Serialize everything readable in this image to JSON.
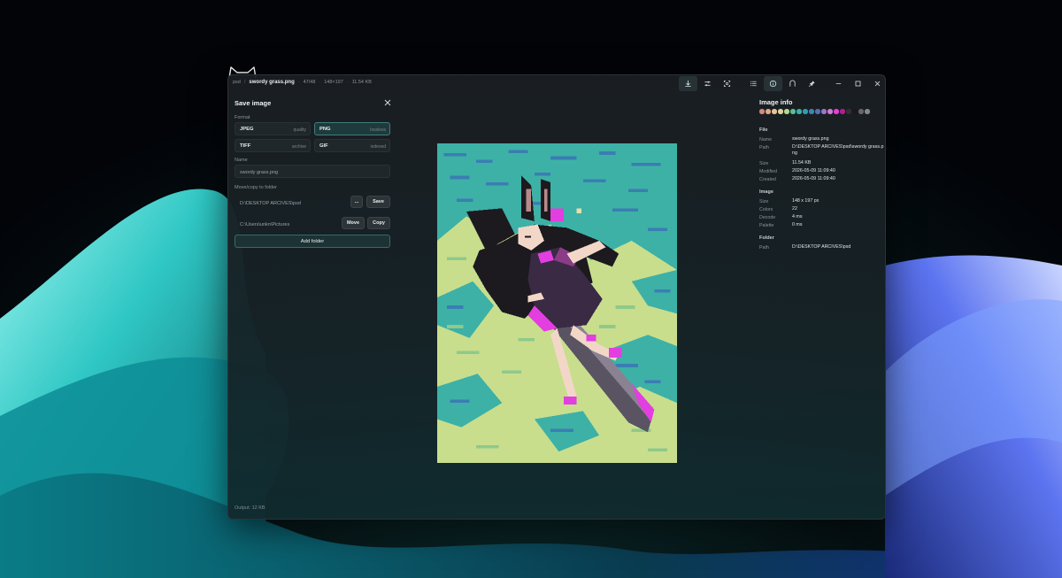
{
  "window": {
    "breadcrumb": {
      "folder": "psd",
      "separator": "/",
      "file": "swordy grass.png",
      "meta": [
        "47/48",
        "148×197",
        "11.54 KB"
      ]
    }
  },
  "toolbar": {
    "buttons": [
      {
        "icon": "download-icon",
        "active": true
      },
      {
        "icon": "sliders-icon",
        "active": false
      },
      {
        "icon": "fullscreen-icon",
        "active": false
      },
      {
        "icon": "list-icon",
        "active": false
      },
      {
        "icon": "info-icon",
        "active": true
      },
      {
        "icon": "magnet-icon",
        "active": false
      },
      {
        "icon": "pin-icon",
        "active": false
      }
    ],
    "window_controls": [
      "minimize-icon",
      "maximize-icon",
      "close-icon"
    ]
  },
  "save_panel": {
    "title": "Save image",
    "format_label": "Format",
    "formats": [
      {
        "name": "JPEG",
        "desc": "quality",
        "selected": false
      },
      {
        "name": "PNG",
        "desc": "lossless",
        "selected": true
      },
      {
        "name": "TIFF",
        "desc": "archive",
        "selected": false
      },
      {
        "name": "GIF",
        "desc": "indexed",
        "selected": false
      }
    ],
    "name_label": "Name",
    "name_value": "swordy grass.png",
    "move_copy_label": "Move/copy to folder",
    "target_folder": "D:\\DESKTOP ARCIVES\\psd",
    "browse_label": "...",
    "save_label": "Save",
    "second_folder": "C:\\Users\\unkn\\Pictures",
    "move_label": "Move",
    "copy_label": "Copy",
    "add_folder_label": "Add folder",
    "output_label": "Output: 12 KB"
  },
  "info_panel": {
    "title": "Image info",
    "palette": [
      "#d48a7a",
      "#e0a890",
      "#e6c39a",
      "#d8d5a0",
      "#b8d88a",
      "#5bbd9a",
      "#3ab0a8",
      "#2f9fb0",
      "#3a86b8",
      "#5a6fb0",
      "#9a78c8",
      "#d47ad0",
      "#e040e0",
      "#b0208a",
      "#3a2a3a",
      "#1a1820",
      "#6a6470",
      "#8a848e"
    ],
    "file_section": "File",
    "file": [
      {
        "key": "Name",
        "value": "swordy grass.png"
      },
      {
        "key": "Path",
        "value": "D:\\DESKTOP ARCIVES\\psd\\swordy grass.png"
      },
      {
        "key": "Size",
        "value": "11.54 KB"
      },
      {
        "key": "Modified",
        "value": "2026-05-09 11:09:40"
      },
      {
        "key": "Created",
        "value": "2026-05-09 11:09:40"
      }
    ],
    "image_section": "Image",
    "image": [
      {
        "key": "Size",
        "value": "148 x 197 px"
      },
      {
        "key": "Colors",
        "value": "22"
      },
      {
        "key": "Decode",
        "value": "4 ms"
      },
      {
        "key": "Palette",
        "value": "0 ms"
      }
    ],
    "folder_section": "Folder",
    "folder": [
      {
        "key": "Path",
        "value": "D:\\DESKTOP ARCIVES\\psd"
      }
    ]
  },
  "colors": {
    "accent": "#3f7d7c",
    "panel_bg": "#20272b",
    "grass_light": "#c9e08e",
    "grass_teal": "#3fb3a8",
    "grass_blue": "#3b7fb5",
    "hair": "#1c1a1f",
    "magenta": "#e23ee0"
  }
}
